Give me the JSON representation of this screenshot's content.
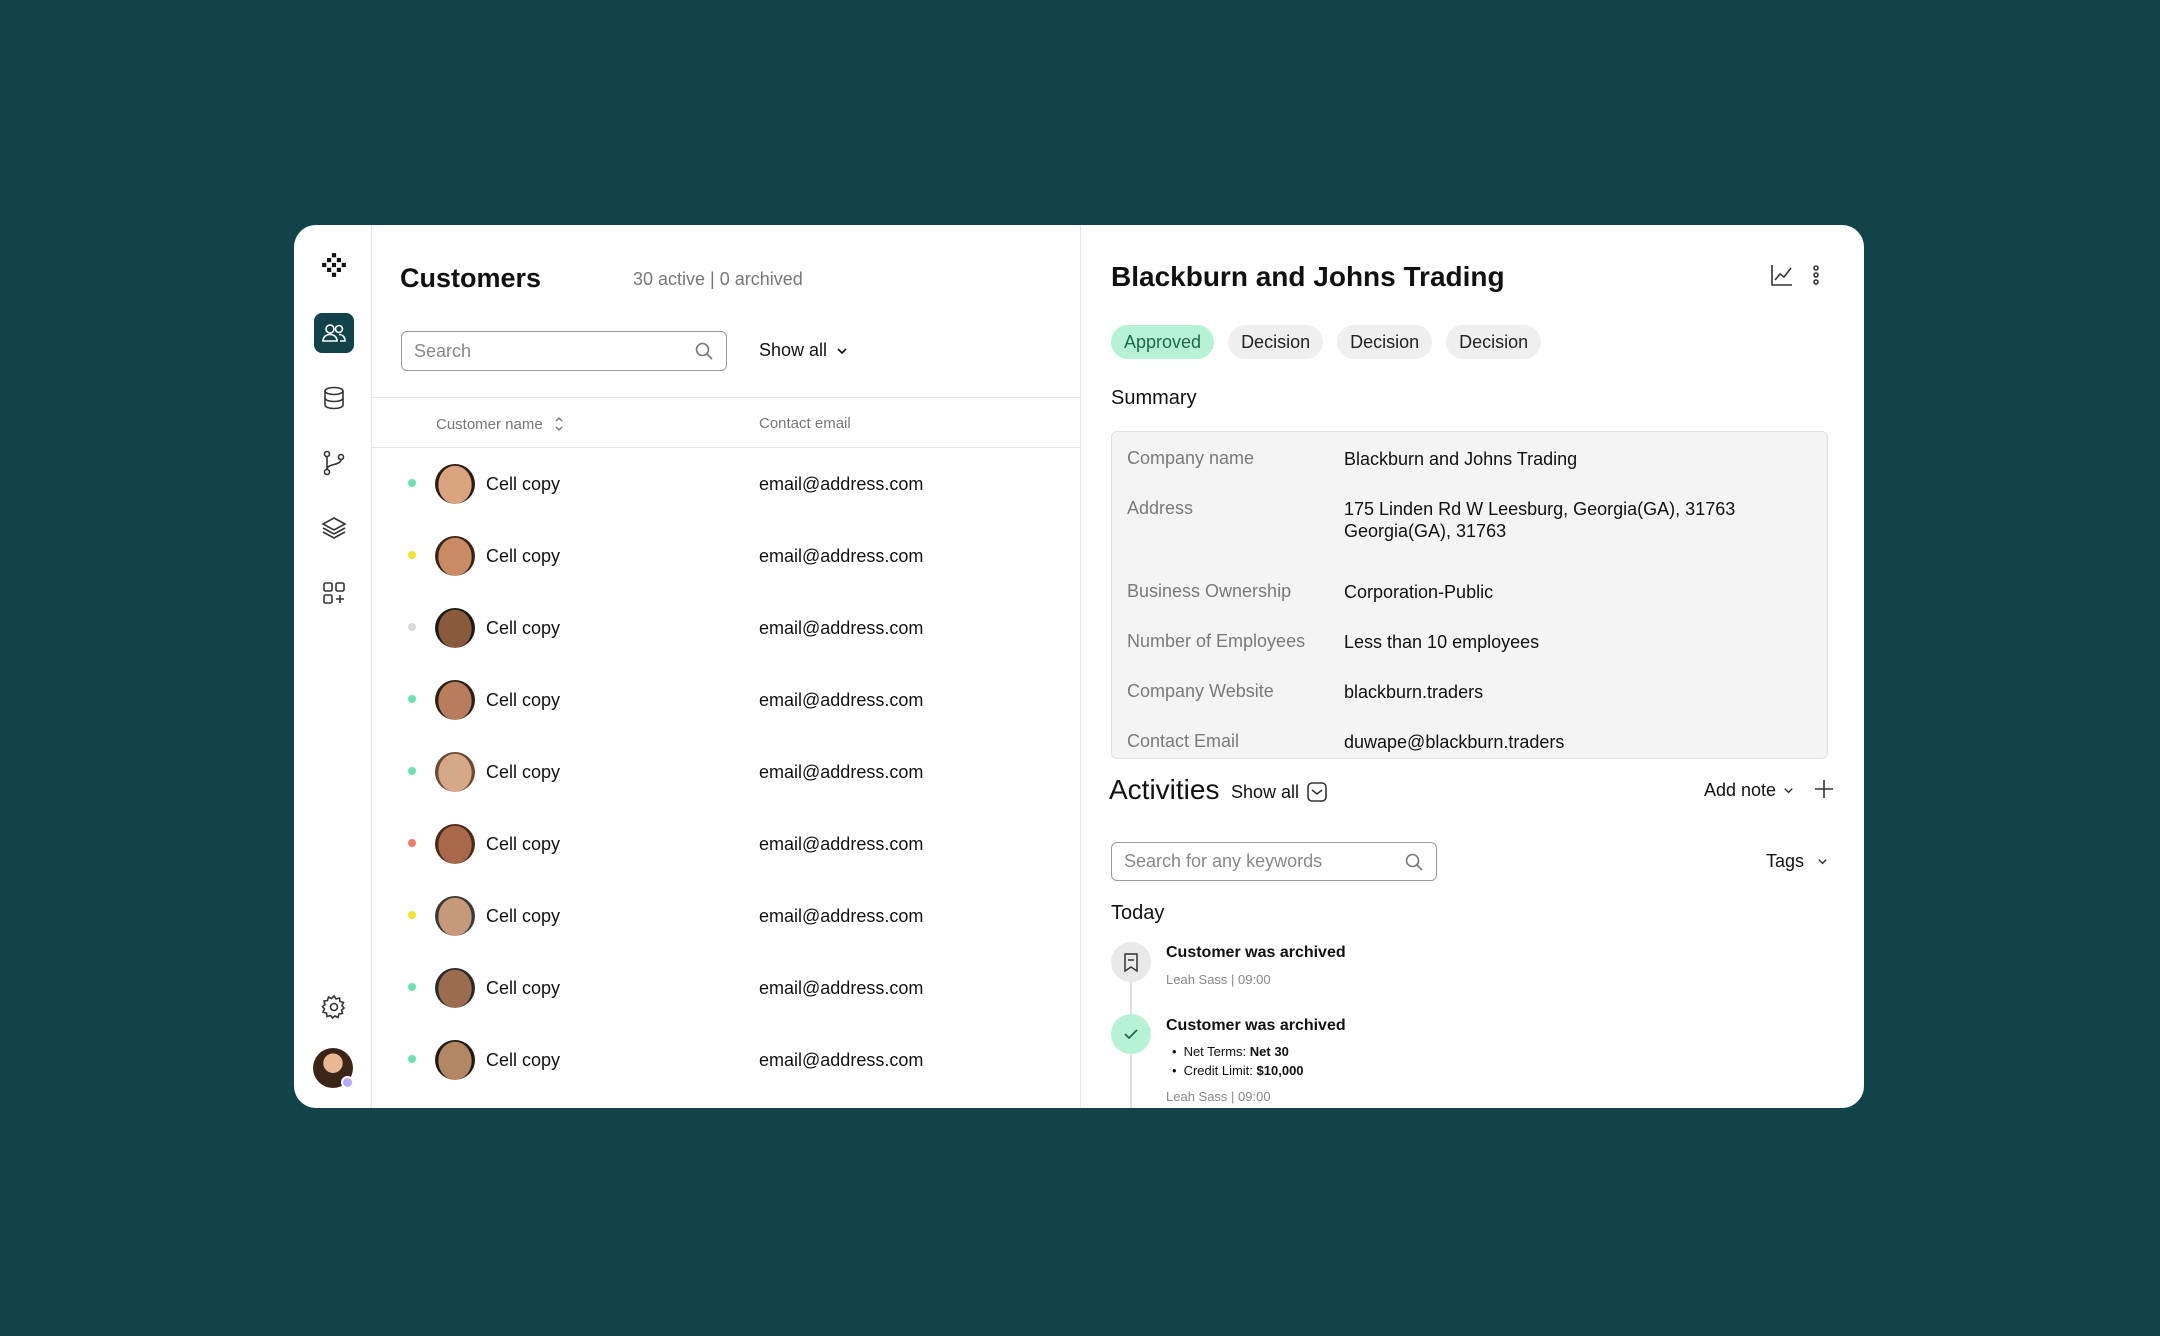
{
  "sidebar": {
    "logo": "logo-mark",
    "items": [
      {
        "name": "customers",
        "icon": "users-icon",
        "active": true
      },
      {
        "name": "database",
        "icon": "database-icon",
        "active": false
      },
      {
        "name": "workflows",
        "icon": "git-branch-icon",
        "active": false
      },
      {
        "name": "layers",
        "icon": "layers-icon",
        "active": false
      },
      {
        "name": "apps",
        "icon": "add-apps-icon",
        "active": false
      }
    ],
    "settings_icon": "gear-icon",
    "accent": "#13434a"
  },
  "customers": {
    "title": "Customers",
    "subtitle": "30 active | 0 archived",
    "search_placeholder": "Search",
    "filter_label": "Show all",
    "columns": {
      "name": "Customer name",
      "email": "Contact email"
    },
    "rows": [
      {
        "name": "Cell copy",
        "email": "email@address.com",
        "status_color": "#6fe0b0"
      },
      {
        "name": "Cell copy",
        "email": "email@address.com",
        "status_color": "#f2e23a"
      },
      {
        "name": "Cell copy",
        "email": "email@address.com",
        "status_color": "#d8d8d8"
      },
      {
        "name": "Cell copy",
        "email": "email@address.com",
        "status_color": "#6fe0b0"
      },
      {
        "name": "Cell copy",
        "email": "email@address.com",
        "status_color": "#6fe0b0"
      },
      {
        "name": "Cell copy",
        "email": "email@address.com",
        "status_color": "#f07a6a"
      },
      {
        "name": "Cell copy",
        "email": "email@address.com",
        "status_color": "#f2e23a"
      },
      {
        "name": "Cell copy",
        "email": "email@address.com",
        "status_color": "#6fe0b0"
      },
      {
        "name": "Cell copy",
        "email": "email@address.com",
        "status_color": "#6fe0b0"
      }
    ]
  },
  "detail": {
    "title": "Blackburn and Johns Trading",
    "chips": [
      {
        "label": "Approved",
        "variant": "approved"
      },
      {
        "label": "Decision",
        "variant": "default"
      },
      {
        "label": "Decision",
        "variant": "default"
      },
      {
        "label": "Decision",
        "variant": "default"
      }
    ],
    "summary_label": "Summary",
    "summary": [
      {
        "key": "Company name",
        "value": "Blackburn and Johns Trading"
      },
      {
        "key": "Address",
        "value": "175 Linden Rd W Leesburg, Georgia(GA), 31763 Georgia(GA), 31763"
      },
      {
        "key": "Business Ownership",
        "value": "Corporation-Public"
      },
      {
        "key": "Number of Employees",
        "value": "Less than 10 employees"
      },
      {
        "key": "Company Website",
        "value": "blackburn.traders"
      },
      {
        "key": "Contact Email",
        "value": "duwape@blackburn.traders"
      }
    ],
    "activities": {
      "title": "Activities",
      "show_all": "Show all",
      "add_note": "Add note",
      "search_placeholder": "Search for any keywords",
      "tags_label": "Tags",
      "group_label": "Today",
      "items": [
        {
          "title": "Customer was archived",
          "meta": "Leah Sass | 09:00",
          "icon": "bookmark-icon"
        },
        {
          "title": "Customer was archived",
          "meta": "Leah Sass | 09:00",
          "icon": "check-icon",
          "bullets": [
            {
              "label": "Net Terms: ",
              "value": "Net 30"
            },
            {
              "label": "Credit Limit: ",
              "value": "$10,000"
            }
          ]
        }
      ]
    }
  }
}
